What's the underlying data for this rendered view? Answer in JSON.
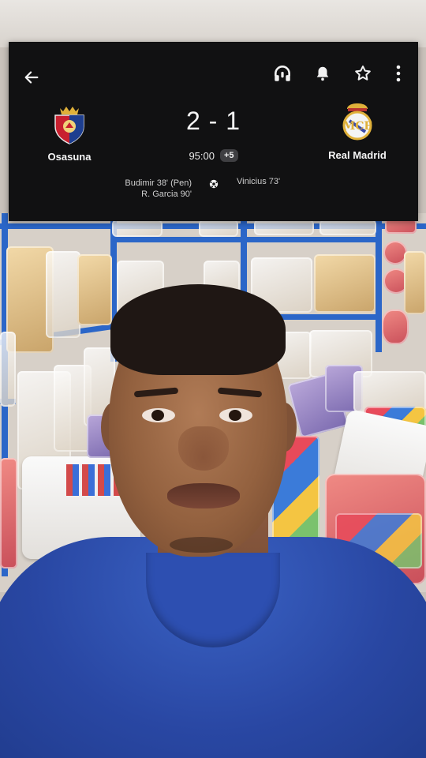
{
  "match": {
    "home_team": "Osasuna",
    "away_team": "Real Madrid",
    "score": "2 - 1",
    "clock": "95:00",
    "added_time": "+5",
    "home_scorers": [
      "Budimir 38' (Pen)",
      "R. Garcia 90'"
    ],
    "away_scorers": [
      "Vinicius 73'"
    ]
  },
  "toolbar": {
    "icons": [
      "back-arrow-icon",
      "headphones-icon",
      "bell-icon",
      "star-icon",
      "more-vert-icon"
    ]
  },
  "colors": {
    "card_background": "#111112",
    "added_time_badge": "#3f3f42",
    "osasuna_red": "#c8202f",
    "osasuna_blue": "#1d3e8f",
    "real_madrid_gold": "#e0b13a",
    "shirt_blue": "#2947a3",
    "shelf_blue": "#2b66c8"
  }
}
